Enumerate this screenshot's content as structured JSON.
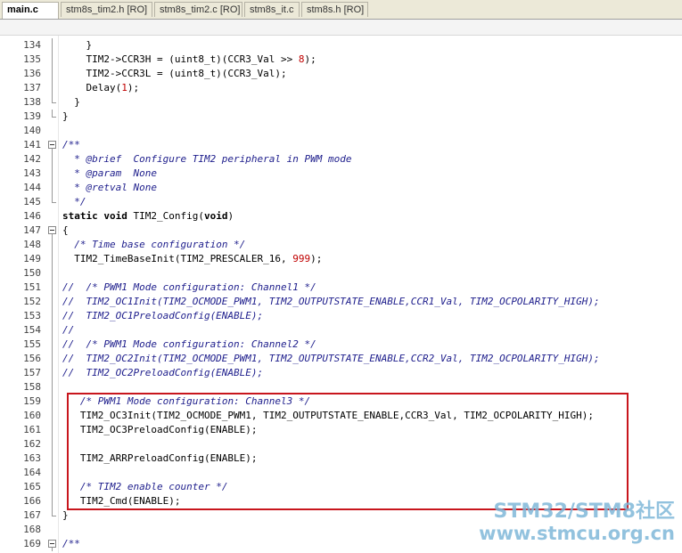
{
  "tabs": [
    {
      "label": "main.c",
      "active": true
    },
    {
      "label": "stm8s_tim2.h [RO]",
      "active": false
    },
    {
      "label": "stm8s_tim2.c [RO]",
      "active": false
    },
    {
      "label": "stm8s_it.c",
      "active": false
    },
    {
      "label": "stm8s.h [RO]",
      "active": false
    }
  ],
  "lines": [
    {
      "num": "134",
      "fold": "line",
      "text": "    }"
    },
    {
      "num": "135",
      "fold": "line",
      "text": "    TIM2->CCR3H = (uint8_t)(CCR3_Val >> 8);"
    },
    {
      "num": "136",
      "fold": "line",
      "text": "    TIM2->CCR3L = (uint8_t)(CCR3_Val);"
    },
    {
      "num": "137",
      "fold": "line",
      "text": "    Delay(1);"
    },
    {
      "num": "138",
      "fold": "end",
      "text": "  }"
    },
    {
      "num": "139",
      "fold": "end",
      "text": "}"
    },
    {
      "num": "140",
      "fold": "none",
      "text": ""
    },
    {
      "num": "141",
      "fold": "box",
      "text": "/**"
    },
    {
      "num": "142",
      "fold": "line",
      "text": "  * @brief  Configure TIM2 peripheral in PWM mode"
    },
    {
      "num": "143",
      "fold": "line",
      "text": "  * @param  None"
    },
    {
      "num": "144",
      "fold": "line",
      "text": "  * @retval None"
    },
    {
      "num": "145",
      "fold": "end",
      "text": "  */"
    },
    {
      "num": "146",
      "fold": "none",
      "text": "static void TIM2_Config(void)"
    },
    {
      "num": "147",
      "fold": "box",
      "text": "{"
    },
    {
      "num": "148",
      "fold": "line",
      "text": "  /* Time base configuration */"
    },
    {
      "num": "149",
      "fold": "line",
      "text": "  TIM2_TimeBaseInit(TIM2_PRESCALER_16, 999);"
    },
    {
      "num": "150",
      "fold": "line",
      "text": ""
    },
    {
      "num": "151",
      "fold": "line",
      "text": "//  /* PWM1 Mode configuration: Channel1 */"
    },
    {
      "num": "152",
      "fold": "line",
      "text": "//  TIM2_OC1Init(TIM2_OCMODE_PWM1, TIM2_OUTPUTSTATE_ENABLE,CCR1_Val, TIM2_OCPOLARITY_HIGH);"
    },
    {
      "num": "153",
      "fold": "line",
      "text": "//  TIM2_OC1PreloadConfig(ENABLE);"
    },
    {
      "num": "154",
      "fold": "line",
      "text": "//"
    },
    {
      "num": "155",
      "fold": "line",
      "text": "//  /* PWM1 Mode configuration: Channel2 */"
    },
    {
      "num": "156",
      "fold": "line",
      "text": "//  TIM2_OC2Init(TIM2_OCMODE_PWM1, TIM2_OUTPUTSTATE_ENABLE,CCR2_Val, TIM2_OCPOLARITY_HIGH);"
    },
    {
      "num": "157",
      "fold": "line",
      "text": "//  TIM2_OC2PreloadConfig(ENABLE);"
    },
    {
      "num": "158",
      "fold": "line",
      "text": ""
    },
    {
      "num": "159",
      "fold": "line",
      "text": "   /* PWM1 Mode configuration: Channel3 */"
    },
    {
      "num": "160",
      "fold": "line",
      "text": "   TIM2_OC3Init(TIM2_OCMODE_PWM1, TIM2_OUTPUTSTATE_ENABLE,CCR3_Val, TIM2_OCPOLARITY_HIGH);"
    },
    {
      "num": "161",
      "fold": "line",
      "text": "   TIM2_OC3PreloadConfig(ENABLE);"
    },
    {
      "num": "162",
      "fold": "line",
      "text": ""
    },
    {
      "num": "163",
      "fold": "line",
      "text": "   TIM2_ARRPreloadConfig(ENABLE);"
    },
    {
      "num": "164",
      "fold": "line",
      "text": ""
    },
    {
      "num": "165",
      "fold": "line",
      "text": "   /* TIM2 enable counter */"
    },
    {
      "num": "166",
      "fold": "line",
      "text": "   TIM2_Cmd(ENABLE);"
    },
    {
      "num": "167",
      "fold": "end",
      "text": "}"
    },
    {
      "num": "168",
      "fold": "none",
      "text": ""
    },
    {
      "num": "169",
      "fold": "box",
      "text": "/**"
    }
  ],
  "watermark": {
    "line1": "STM32/STM8社区",
    "line2": "www.stmcu.org.cn"
  },
  "colors": {
    "highlight_border": "#c8161d",
    "comment": "#1e1e8c",
    "number": "#c00000",
    "watermark": "#7fb8d9"
  }
}
